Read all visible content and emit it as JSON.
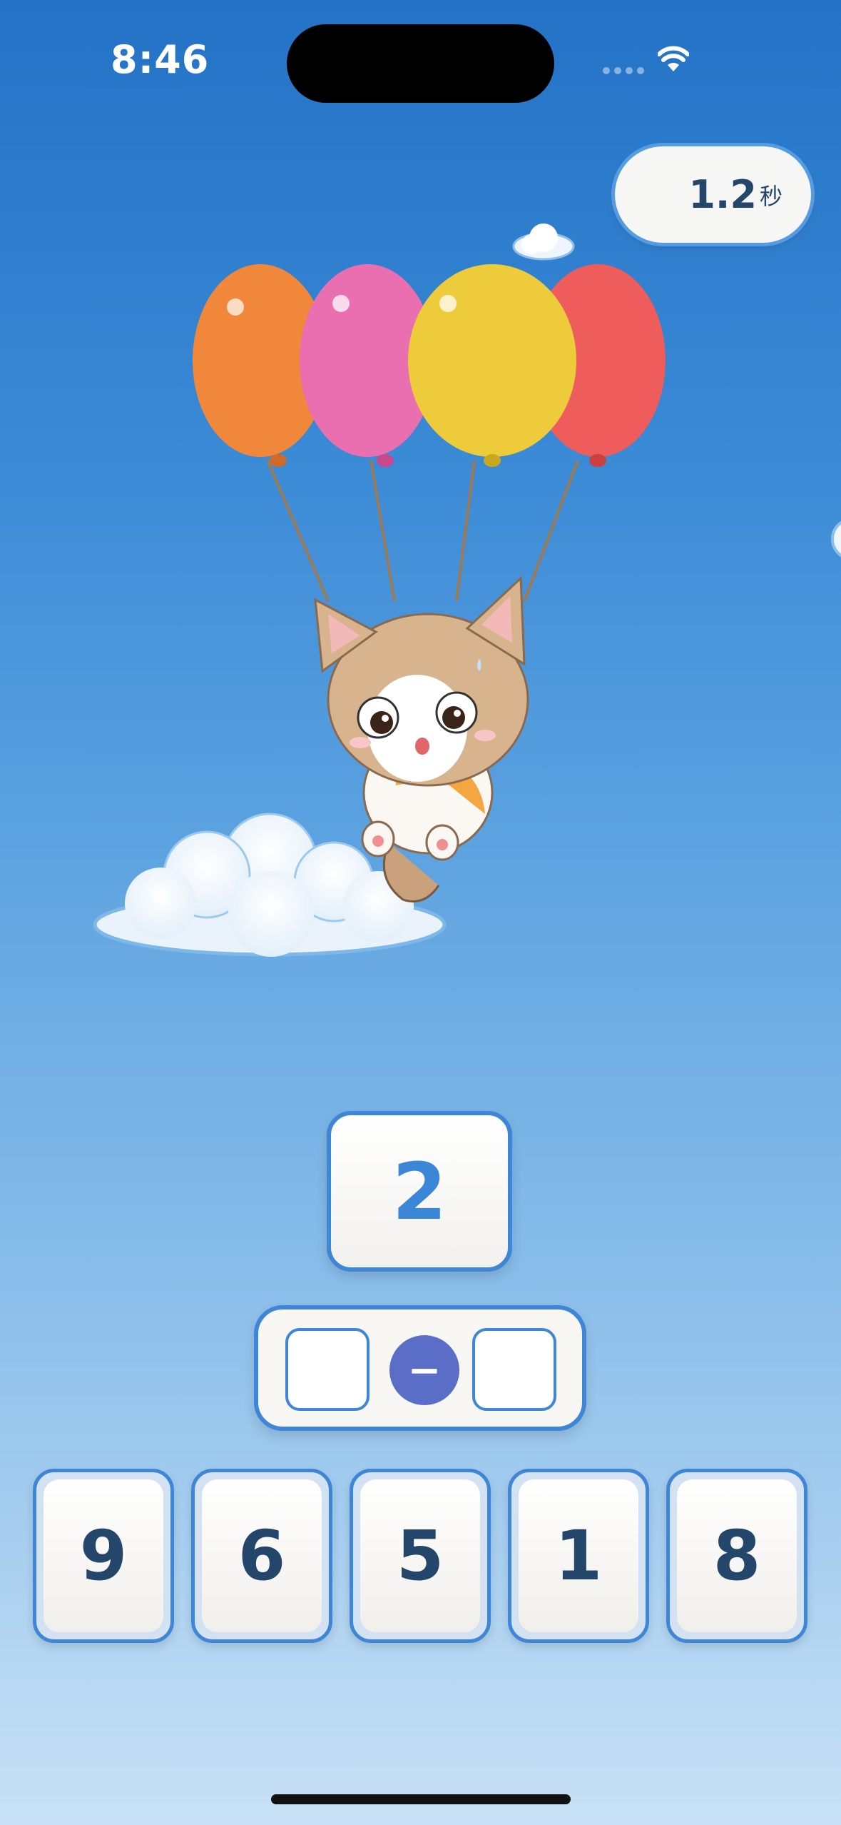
{
  "status_bar": {
    "time": "8:46"
  },
  "timer": {
    "value": "1.2",
    "unit": "秒"
  },
  "target": {
    "value": "2"
  },
  "equation": {
    "operator": "−"
  },
  "number_tiles": [
    "9",
    "6",
    "5",
    "1",
    "8"
  ],
  "balloons": [
    {
      "color": "#f0873a"
    },
    {
      "color": "#ea6fb0"
    },
    {
      "color": "#eecb3a"
    },
    {
      "color": "#ef5c5c"
    }
  ],
  "icons": {
    "wifi": "wifi-icon",
    "signal": "signal-dots-icon"
  }
}
